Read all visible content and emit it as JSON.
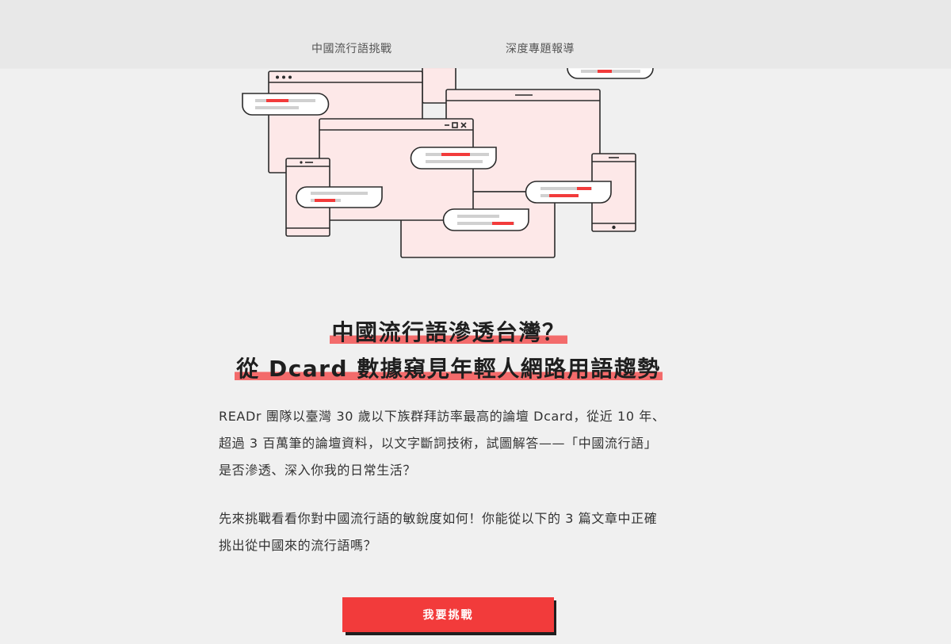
{
  "nav": {
    "items": [
      {
        "label": "中國流行語挑戰"
      },
      {
        "label": "深度專題報導"
      }
    ]
  },
  "headline": {
    "line1": "中國流行語滲透台灣？",
    "line2": "從 Dcard 數據窺見年輕人網路用語趨勢"
  },
  "intro": {
    "paragraph1": [
      "READr 團隊以臺灣 30 歲以下族群拜訪率最高的論壇 Dcard，從近 10 年、",
      "超過 3 百萬筆的論壇資料，以文字斷詞技術，試圖解答——「中國流行語」",
      "是否滲透、深入你我的日常生活？"
    ],
    "paragraph2": [
      "先來挑戰看看你對中國流行語的敏銳度如何！你能從以下的 3 篇文章中正確",
      "挑出從中國來的流行語嗎？"
    ]
  },
  "cta": {
    "label": "我要挑戰"
  },
  "colors": {
    "accent_red": "#f23b3b",
    "highlight": "#f36b6b",
    "window_fill": "#fde8e8",
    "outline": "#2b2b2b",
    "background": "#f0f0f0"
  },
  "illustration": {
    "icons": [
      "browser-window-icon",
      "chat-bubble-icon",
      "phone-icon"
    ]
  }
}
